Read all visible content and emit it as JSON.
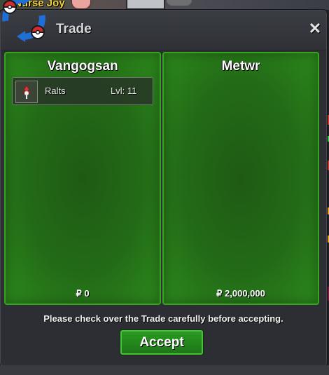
{
  "world": {
    "npc_name": "Nurse Joy"
  },
  "window": {
    "title": "Trade",
    "close_symbol": "✕",
    "logo_icon": "pokeball-arrows-icon"
  },
  "left_panel": {
    "player_name": "Vangogsan",
    "items": [
      {
        "icon": "ralts-sprite-icon",
        "name": "Ralts",
        "level": "Lvl: 11"
      }
    ],
    "money": "₽ 0"
  },
  "right_panel": {
    "player_name": "Metwr",
    "items": [],
    "money": "₽ 2,000,000"
  },
  "notice": "Please check over the Trade carefully before accepting.",
  "accept_label": "Accept",
  "colors": {
    "panel_green": "#236b17",
    "panel_border": "#35a41f",
    "accept_green": "#2a9a22",
    "npc_name_color": "#f4d23a"
  }
}
